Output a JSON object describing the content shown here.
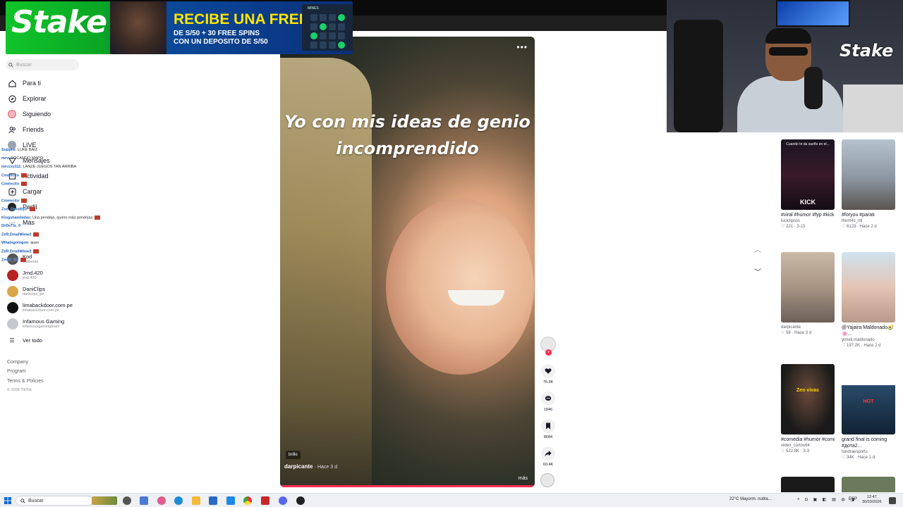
{
  "banner": {
    "brand": "Stake",
    "headline": "RECIBE UNA FREEBET",
    "subline1": "DE S/50 + 30 FREE SPINS",
    "subline2": "CON UN DEPOSITO DE S/50",
    "game": "MINES"
  },
  "cam": {
    "overlay_brand": "Stake"
  },
  "sidebar": {
    "search_placeholder": "Buscar",
    "nav": [
      {
        "label": "Para ti",
        "icon": "home-icon"
      },
      {
        "label": "Explorar",
        "icon": "compass-icon"
      },
      {
        "label": "Siguiendo",
        "icon": "following-icon"
      },
      {
        "label": "Friends",
        "icon": "friends-icon"
      },
      {
        "label": "LIVE",
        "icon": "live-icon"
      },
      {
        "label": "Mensajes",
        "icon": "message-icon"
      },
      {
        "label": "Actividad",
        "icon": "activity-icon"
      },
      {
        "label": "Cargar",
        "icon": "upload-icon"
      },
      {
        "label": "Perfil",
        "icon": "profile-icon"
      },
      {
        "label": "Más",
        "icon": "more-icon"
      }
    ],
    "accounts": [
      {
        "name": "Kod",
        "handle": "kodbeats"
      },
      {
        "name": "Jmd.420",
        "handle": "jmd.420"
      },
      {
        "name": "DaniClips",
        "handle": "daniclips_pe"
      },
      {
        "name": "limabackdoor.com.pe",
        "handle": "limabackdoor.com.pe"
      },
      {
        "name": "Infamous Gaming",
        "handle": "infamousgamingteam"
      }
    ],
    "see_all": "Ver todo",
    "footer": {
      "company": "Company",
      "program": "Program",
      "terms": "Terms & Policies",
      "copyright": "© 2026 TikTok"
    }
  },
  "chat": [
    {
      "user": "Supplis",
      "msg": ": LUKE BAIZ"
    },
    {
      "user": "mrv",
      "msg": ": ROCANDO MAPO"
    },
    {
      "user": "mrccxz111",
      "msg": ": LANZE JUEGOS TAN ARRIBA"
    },
    {
      "user": "Cmencito",
      "msg": ""
    },
    {
      "user": "Cmencito",
      "msg": ""
    },
    {
      "user": "Cmencito",
      "msg": ""
    },
    {
      "user": "Zoe_Goodbye",
      "msg": ""
    },
    {
      "user": "Kingshambidas",
      "msg": ": Una pendeja, quiero más pendejas"
    },
    {
      "user": "DrDeTls_0",
      "msg": ""
    },
    {
      "user": "ZeR.DeadWiew2",
      "msg": ""
    },
    {
      "user": "Whatsgoingon",
      "msg": ": ques"
    },
    {
      "user": "ZeR.DeadWiew2",
      "msg": ""
    },
    {
      "user": "ZenR_Dir",
      "msg": ""
    }
  ],
  "video": {
    "caption": "Yo con mis ideas de genio incomprendido",
    "tag": "brillo",
    "author": "darpicante",
    "time": "· Hace 3 d",
    "more": "más"
  },
  "actions": {
    "likes": "76.3K",
    "comments": "1846",
    "saves": "8684",
    "shares": "60.4K"
  },
  "related": [
    {
      "title": "#viral #humor #fyp #kick #zull...",
      "user": "luciclipsss",
      "meta": "221 · 3-13",
      "thumb_label": "KICK",
      "thumb_top": "Cuando te da sueño en el..."
    },
    {
      "title": "#foryou #parati",
      "user": "thom4s_ntl",
      "meta": "6123 · Hace 2 d"
    },
    {
      "title": "",
      "user": "darpicante",
      "meta": "58 · Hace 3 d"
    },
    {
      "title": "@Yajaira Maldonado🥑🌸...",
      "user": "yimeli.maldonado",
      "meta": "197.2K · Hace 2 d"
    },
    {
      "title": "#comedia #humor #comidahumor...",
      "user": "video_cortos64",
      "meta": "522.8K · 3-3",
      "thumb_label": "Zeo vivas"
    },
    {
      "title": "grand final is coming #дота2...",
      "user": "tundraesports",
      "meta": "34K · Hace 1 d",
      "thumb_label": "HOT"
    }
  ],
  "taskbar": {
    "search": "Buscar",
    "weather": "22°C  Mayorm. nubla...",
    "lang": "ESP",
    "time": "12:47",
    "date": "30/03/2026"
  }
}
